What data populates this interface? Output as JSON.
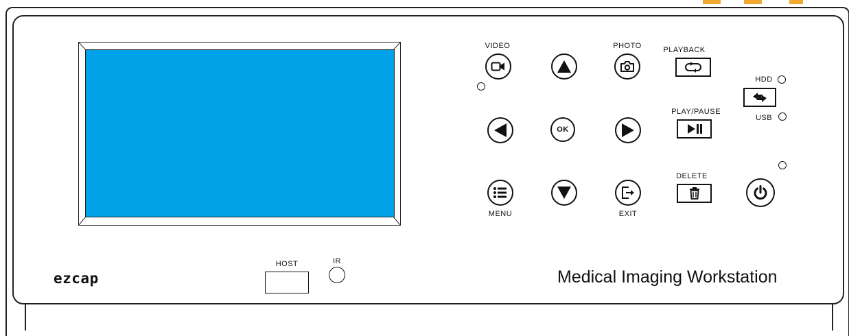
{
  "labels": {
    "video": "VIDEO",
    "photo": "PHOTO",
    "playback": "PLAYBACK",
    "play_pause": "PLAY/PAUSE",
    "delete": "DELETE",
    "menu": "MENU",
    "exit": "EXIT",
    "hdd": "HDD",
    "usb": "USB",
    "host": "HOST",
    "ir": "IR",
    "ok": "OK"
  },
  "brand": "ezcap",
  "product_name": "Medical Imaging Workstation",
  "colors": {
    "screen": "#00a1e6",
    "outline": "#111111",
    "accent": "#f0a830"
  },
  "icons": {
    "video": "video-camera-icon",
    "up": "triangle-up-icon",
    "photo": "camera-icon",
    "playback": "loop-icon",
    "switch": "swap-arrows-icon",
    "left": "triangle-left-icon",
    "right": "triangle-right-icon",
    "play_pause": "play-pause-icon",
    "menu": "list-icon",
    "down": "triangle-down-icon",
    "exit": "exit-icon",
    "delete": "trash-icon",
    "power": "power-icon"
  }
}
